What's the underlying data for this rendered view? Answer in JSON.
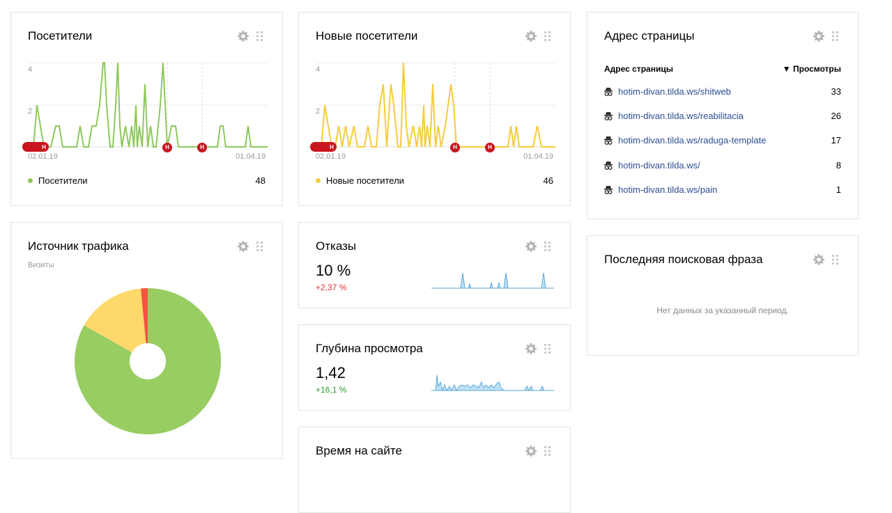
{
  "visitors": {
    "title": "Посетители",
    "y_ticks": [
      "4",
      "2"
    ],
    "date_start": "02.01.19",
    "date_end": "01.04.19",
    "legend_label": "Посетители",
    "legend_value": "48",
    "color": "#8ec85b"
  },
  "new_visitors": {
    "title": "Новые посетители",
    "y_ticks": [
      "4",
      "2"
    ],
    "date_start": "02.01.19",
    "date_end": "01.04.19",
    "legend_label": "Новые посетители",
    "legend_value": "46",
    "color": "#f5cc3c"
  },
  "annotation_marker": "Н",
  "pages": {
    "title": "Адрес страницы",
    "col_page": "Адрес страницы",
    "col_views": "▼ Просмотры",
    "rows": [
      {
        "url": "hotim-divan.tilda.ws/shitweb",
        "views": "33"
      },
      {
        "url": "hotim-divan.tilda.ws/reabilitacia",
        "views": "26"
      },
      {
        "url": "hotim-divan.tilda.ws/raduga-template",
        "views": "17"
      },
      {
        "url": "hotim-divan.tilda.ws/",
        "views": "8"
      },
      {
        "url": "hotim-divan.tilda.ws/pain",
        "views": "1"
      }
    ]
  },
  "traffic": {
    "title": "Источник трафика",
    "subtitle": "Визиты",
    "colors": [
      "#98cd62",
      "#fed86b",
      "#f2553f"
    ]
  },
  "bounce": {
    "title": "Отказы",
    "value": "10 %",
    "delta": "+2,37 %"
  },
  "depth": {
    "title": "Глубина просмотра",
    "value": "1,42",
    "delta": "+16,1 %"
  },
  "time": {
    "title": "Время на сайте"
  },
  "search_phrase": {
    "title": "Последняя поисковая фраза",
    "empty_text": "Нет данных за указанный период."
  }
}
